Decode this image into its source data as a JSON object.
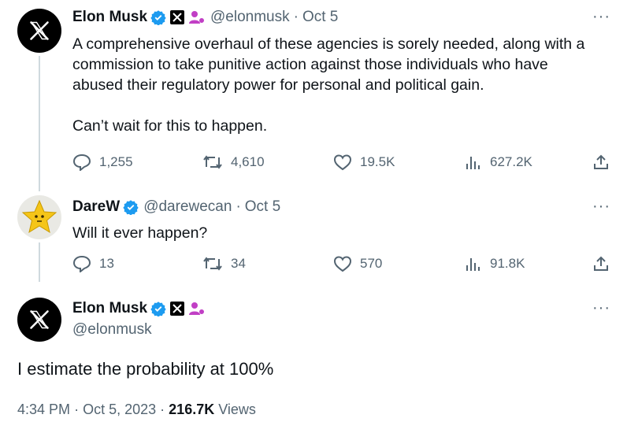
{
  "tweet1": {
    "name": "Elon Musk",
    "handle": "@elonmusk",
    "sep": "·",
    "date": "Oct 5",
    "text_line1": "A comprehensive overhaul of these agencies is sorely needed, along with a",
    "text_line2": "commission to take punitive action against those individuals who have",
    "text_line3": "abused their regulatory power for personal and political gain.",
    "text_line4": "Can’t wait for this to happen.",
    "replies": "1,255",
    "reposts": "4,610",
    "likes": "19.5K",
    "views": "627.2K"
  },
  "tweet2": {
    "name": "DareW",
    "handle": "@darewecan",
    "sep": "·",
    "date": "Oct 5",
    "text": "Will it ever happen?",
    "replies": "13",
    "reposts": "34",
    "likes": "570",
    "views": "91.8K"
  },
  "main_tweet": {
    "name": "Elon Musk",
    "handle": "@elonmusk",
    "text": "I estimate the probability at 100%",
    "time": "4:34 PM",
    "sep1": "·",
    "date": "Oct 5, 2023",
    "sep2": "·",
    "views_count": "216.7K",
    "views_label": "Views"
  },
  "more_label": "···",
  "colors": {
    "verified": "#1d9bf0",
    "affiliate": "#c13fc5",
    "secondary": "#536471",
    "line": "#cfd9de"
  },
  "icons": [
    "x-logo-icon",
    "verified-badge-icon",
    "x-affiliate-icon",
    "person-affiliate-icon",
    "reply-icon",
    "repost-icon",
    "like-icon",
    "views-icon",
    "share-icon",
    "more-icon",
    "star-face-icon"
  ]
}
